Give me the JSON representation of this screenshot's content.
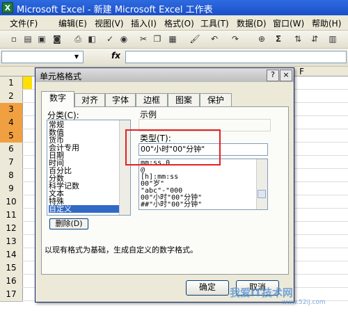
{
  "app": {
    "title": "Microsoft Excel - 新建 Microsoft Excel 工作表",
    "icon_letter": "X"
  },
  "menu": [
    "文件(F)",
    "编辑(E)",
    "视图(V)",
    "插入(I)",
    "格式(O)",
    "工具(T)",
    "数据(D)",
    "窗口(W)",
    "帮助(H)"
  ],
  "toolbar": {
    "sum_symbol": "Σ",
    "fx_label": "fx"
  },
  "sheet": {
    "rows": [
      "1",
      "2",
      "3",
      "4",
      "5",
      "6",
      "7",
      "8",
      "9",
      "10",
      "11",
      "12",
      "13",
      "14",
      "15",
      "16",
      "17"
    ],
    "col_visible": "F"
  },
  "dialog": {
    "title": "单元格格式",
    "help_btn": "?",
    "close_btn": "×",
    "tabs": [
      "数字",
      "对齐",
      "字体",
      "边框",
      "图案",
      "保护"
    ],
    "category_label": "分类(C):",
    "categories": [
      "常规",
      "数值",
      "货币",
      "会计专用",
      "日期",
      "时间",
      "百分比",
      "分数",
      "科学记数",
      "文本",
      "特殊",
      "自定义"
    ],
    "selected_category": "自定义",
    "sample_label": "示例",
    "type_label": "类型(T):",
    "type_value": "00\"小时\"00\"分钟\"",
    "formats": [
      "mm:ss.0",
      "@",
      "[h]:mm:ss",
      "00\"岁\"",
      "\"abc\"-\"000",
      "00\"小时\"00\"分钟\"",
      "##\"小时\"00\"分钟\""
    ],
    "delete_button": "删除(D)",
    "description": "以现有格式为基础，生成自定义的数字格式。",
    "ok_button": "确定",
    "cancel_button": "取消"
  },
  "watermark": {
    "text": "我爱IT技术网",
    "url": "www.52ij.com"
  },
  "colors": {
    "accent_highlight": "#e62020",
    "selected_row": "#f0a040",
    "selection_blue": "#316ac5"
  }
}
